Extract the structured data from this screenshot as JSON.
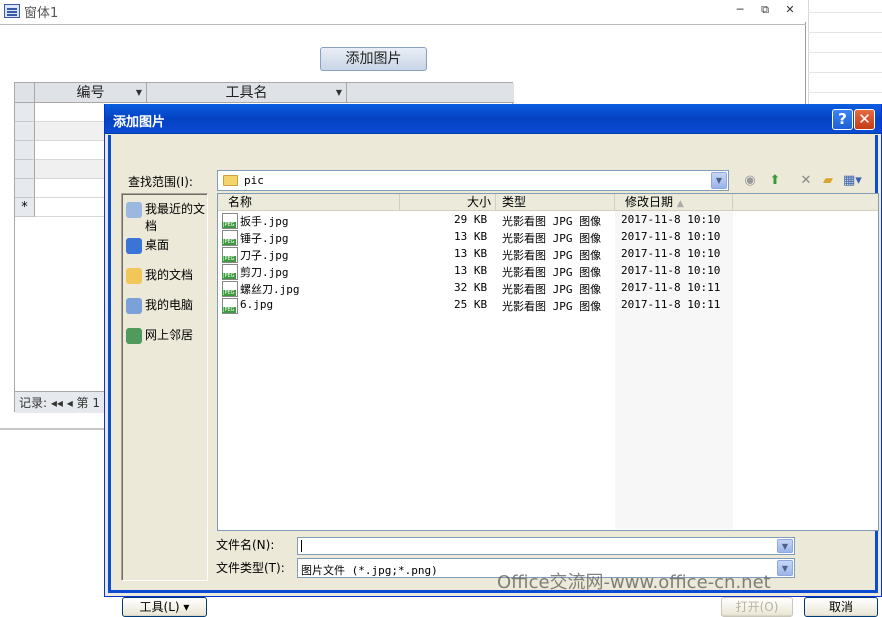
{
  "form": {
    "title": "窗体1",
    "minimize": "─",
    "restore": "⧉",
    "close": "✕",
    "add_image_button": "添加图片",
    "columns": [
      "编号",
      "工具名"
    ],
    "new_row_marker": "*",
    "record_nav": "记录: ◂◂ ◂ 第 1"
  },
  "dialog": {
    "title": "添加图片",
    "help": "?",
    "close": "✕",
    "lookin_label": "查找范围(I):",
    "lookin_value": "pic",
    "places": [
      {
        "label": "我最近的文档",
        "icon": "recent-documents-icon",
        "color": "#9bb8e0"
      },
      {
        "label": "桌面",
        "icon": "desktop-icon",
        "color": "#3a74d6"
      },
      {
        "label": "我的文档",
        "icon": "my-documents-icon",
        "color": "#f1c75a"
      },
      {
        "label": "我的电脑",
        "icon": "my-computer-icon",
        "color": "#7aa1d8"
      },
      {
        "label": "网上邻居",
        "icon": "network-places-icon",
        "color": "#4f9a5c"
      }
    ],
    "columns": {
      "name": "名称",
      "size": "大小",
      "type": "类型",
      "modified": "修改日期"
    },
    "files": [
      {
        "name": "扳手.jpg",
        "size": "29 KB",
        "type": "光影看图 JPG 图像",
        "modified": "2017-11-8 10:10"
      },
      {
        "name": "锤子.jpg",
        "size": "13 KB",
        "type": "光影看图 JPG 图像",
        "modified": "2017-11-8 10:10"
      },
      {
        "name": "刀子.jpg",
        "size": "13 KB",
        "type": "光影看图 JPG 图像",
        "modified": "2017-11-8 10:10"
      },
      {
        "name": "剪刀.jpg",
        "size": "13 KB",
        "type": "光影看图 JPG 图像",
        "modified": "2017-11-8 10:10"
      },
      {
        "name": "螺丝刀.jpg",
        "size": "32 KB",
        "type": "光影看图 JPG 图像",
        "modified": "2017-11-8 10:11"
      },
      {
        "name": "6.jpg",
        "size": "25 KB",
        "type": "光影看图 JPG 图像",
        "modified": "2017-11-8 10:11"
      }
    ],
    "filename_label": "文件名(N):",
    "filename_value": "",
    "filetype_label": "文件类型(T):",
    "filetype_value": "图片文件 (*.jpg;*.png)",
    "tools_button": "工具(L) ▾",
    "open_button": "打开(O)",
    "cancel_button": "取消"
  },
  "watermark": "Office交流网-www.office-cn.net"
}
